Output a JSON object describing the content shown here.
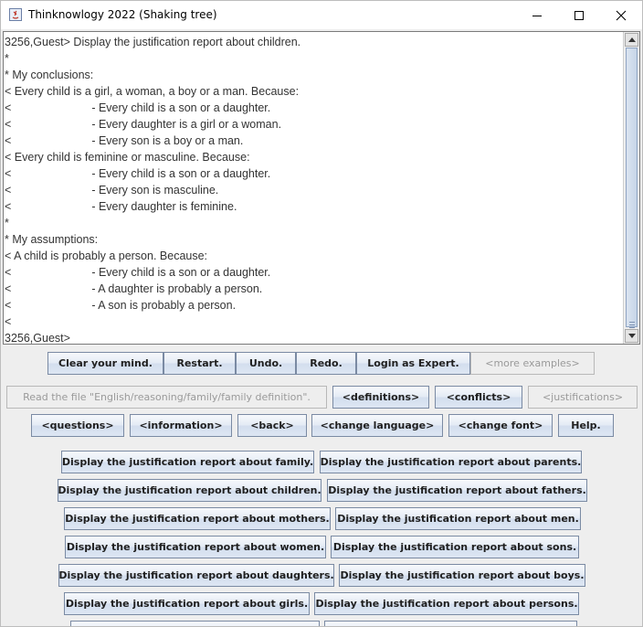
{
  "window": {
    "title": "Thinknowlogy 2022 (Shaking tree)"
  },
  "output": {
    "lines": [
      {
        "prefix": "3256,Guest>",
        "text": " Display the justification report about children."
      },
      {
        "prefix": "*",
        "text": ""
      },
      {
        "prefix": "*",
        "text": " My conclusions:"
      },
      {
        "prefix": "<",
        "text": " Every child is a girl, a woman, a boy or a man. Because:"
      },
      {
        "prefix": "<",
        "indent": true,
        "text": "- Every child is a son or a daughter."
      },
      {
        "prefix": "<",
        "indent": true,
        "text": "- Every daughter is a girl or a woman."
      },
      {
        "prefix": "<",
        "indent": true,
        "text": "- Every son is a boy or a man."
      },
      {
        "prefix": "<",
        "text": " Every child is feminine or masculine. Because:"
      },
      {
        "prefix": "<",
        "indent": true,
        "text": "- Every child is a son or a daughter."
      },
      {
        "prefix": "<",
        "indent": true,
        "text": "- Every son is masculine."
      },
      {
        "prefix": "<",
        "indent": true,
        "text": "- Every daughter is feminine."
      },
      {
        "prefix": "*",
        "text": ""
      },
      {
        "prefix": "*",
        "text": " My assumptions:"
      },
      {
        "prefix": "<",
        "text": " A child is probably a person. Because:"
      },
      {
        "prefix": "<",
        "indent": true,
        "text": "- Every child is a son or a daughter."
      },
      {
        "prefix": "<",
        "indent": true,
        "text": "- A daughter is probably a person."
      },
      {
        "prefix": "<",
        "indent": true,
        "text": "- A son is probably a person."
      },
      {
        "prefix": "<",
        "text": ""
      },
      {
        "prefix": "3256,Guest>",
        "text": ""
      }
    ]
  },
  "toolbar": {
    "clear": "Clear your mind.",
    "restart": "Restart.",
    "undo": "Undo.",
    "redo": "Redo.",
    "login": "Login as Expert.",
    "more_examples": "<more examples>",
    "read_file": "Read the file \"English/reasoning/family/family definition\".",
    "definitions": "<definitions>",
    "conflicts": "<conflicts>",
    "justifications": "<justifications>",
    "questions": "<questions>",
    "information": "<information>",
    "back": "<back>",
    "change_language": "<change language>",
    "change_font": "<change font>",
    "help": "Help."
  },
  "reports": {
    "family": "Display the justification report about family.",
    "parents": "Display the justification report about parents.",
    "children": "Display the justification report about children.",
    "fathers": "Display the justification report about fathers.",
    "mothers": "Display the justification report about mothers.",
    "men": "Display the justification report about men.",
    "women": "Display the justification report about women.",
    "sons": "Display the justification report about sons.",
    "daughters": "Display the justification report about daughters.",
    "boys": "Display the justification report about boys.",
    "girls": "Display the justification report about girls.",
    "persons": "Display the justification report about persons."
  }
}
